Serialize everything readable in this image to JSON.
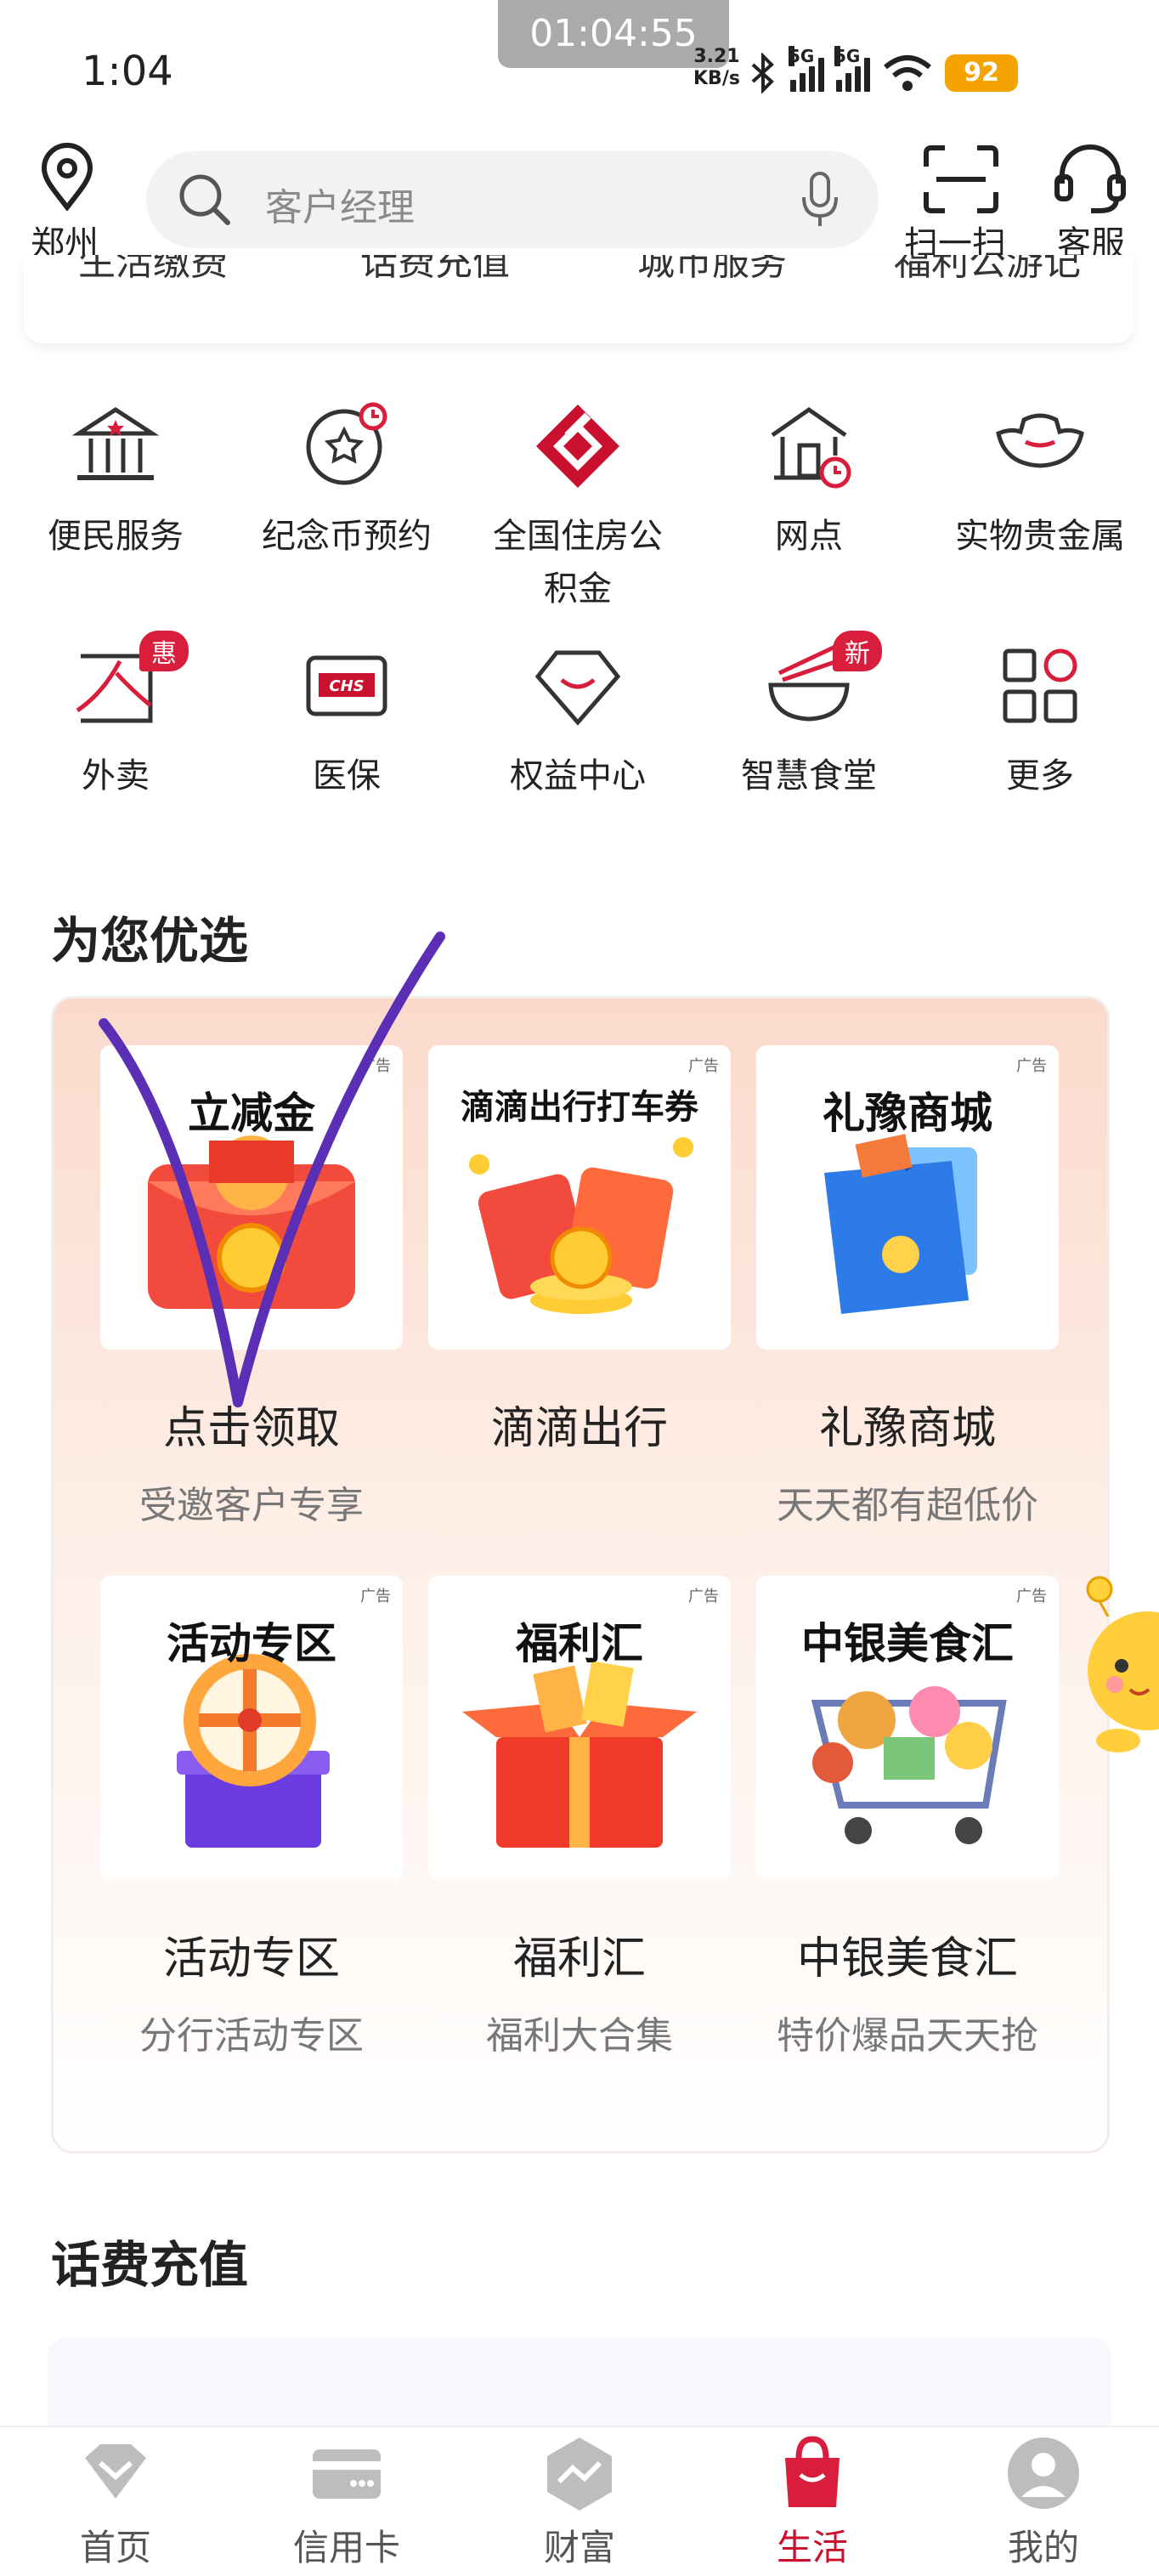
{
  "status_bar": {
    "time": "1:04",
    "record_timer": "01:04:55",
    "net_speed_value": "3.21",
    "net_speed_unit": "KB/s",
    "sig1_label": "5G",
    "sig2_label": "5G",
    "battery": "92"
  },
  "header": {
    "location": "郑州",
    "search_placeholder": "客户经理",
    "scan_label": "扫一扫",
    "service_label": "客服"
  },
  "partial_row": [
    "生活缴费",
    "话费充值",
    "城市服务",
    "福利公游记"
  ],
  "quick_grid": [
    {
      "label": "便民服务",
      "icon": "bank-building-icon"
    },
    {
      "label": "纪念币预约",
      "icon": "coin-star-icon"
    },
    {
      "label": "全国住房公积金",
      "label_line1": "全国住房公",
      "label_line2": "积金",
      "icon": "housing-fund-logo-icon"
    },
    {
      "label": "网点",
      "icon": "branch-clock-icon"
    },
    {
      "label": "实物贵金属",
      "icon": "gold-ingot-icon"
    },
    {
      "label": "外卖",
      "icon": "takeout-icon",
      "badge": "惠"
    },
    {
      "label": "医保",
      "icon": "chs-card-icon"
    },
    {
      "label": "权益中心",
      "icon": "diamond-icon"
    },
    {
      "label": "智慧食堂",
      "icon": "bowl-chopsticks-icon",
      "badge": "新"
    },
    {
      "label": "更多",
      "icon": "grid-more-icon"
    }
  ],
  "featured": {
    "title": "为您优选",
    "ad_label": "广告",
    "items": [
      {
        "headline": "立减金",
        "title": "点击领取",
        "subtitle": "受邀客户专享"
      },
      {
        "headline": "滴滴出行打车券",
        "title": "滴滴出行",
        "subtitle": ""
      },
      {
        "headline": "礼豫商城",
        "title": "礼豫商城",
        "subtitle": "天天都有超低价"
      },
      {
        "headline": "活动专区",
        "title": "活动专区",
        "subtitle": "分行活动专区"
      },
      {
        "headline": "福利汇",
        "title": "福利汇",
        "subtitle": "福利大合集"
      },
      {
        "headline": "中银美食汇",
        "title": "中银美食汇",
        "subtitle": "特价爆品天天抢"
      }
    ]
  },
  "recharge": {
    "title": "话费充值"
  },
  "tabbar": [
    {
      "label": "首页",
      "icon": "home-diamond-icon",
      "active": false
    },
    {
      "label": "信用卡",
      "icon": "credit-card-icon",
      "active": false
    },
    {
      "label": "财富",
      "icon": "wealth-chart-icon",
      "active": false
    },
    {
      "label": "生活",
      "icon": "shopping-bag-icon",
      "active": true
    },
    {
      "label": "我的",
      "icon": "profile-icon",
      "active": false
    }
  ],
  "colors": {
    "brand": "#c9102e",
    "accent_gold": "#f5a300"
  }
}
